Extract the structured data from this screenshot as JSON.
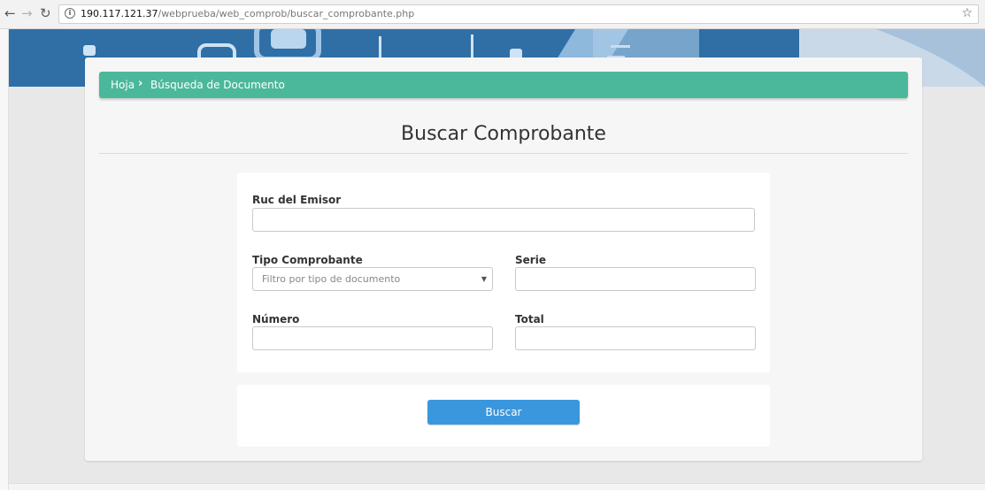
{
  "browser": {
    "url_host": "190.117.121.37",
    "url_path": "/webprueba/web_comprob/buscar_comprobante.php",
    "info_glyph": "i",
    "icons": {
      "back": "arrow-left",
      "forward": "arrow-right",
      "reload": "reload",
      "info": "info-circle",
      "bookmark": "star"
    }
  },
  "breadcrumb": {
    "home": "Hoja",
    "separator_icon": "chevron-right",
    "current": "Búsqueda de Documento"
  },
  "page": {
    "title": "Buscar Comprobante"
  },
  "form": {
    "ruc_label": "Ruc del Emisor",
    "ruc_value": "",
    "tipo_label": "Tipo Comprobante",
    "tipo_selected": "Filtro por tipo de documento",
    "serie_label": "Serie",
    "serie_value": "",
    "numero_label": "Número",
    "numero_value": "",
    "total_label": "Total",
    "total_value": ""
  },
  "actions": {
    "search_label": "Buscar"
  },
  "colors": {
    "breadcrumb_bg": "#4cb89b",
    "button_bg": "#3a97de",
    "banner_bg": "#2f6fa6"
  }
}
